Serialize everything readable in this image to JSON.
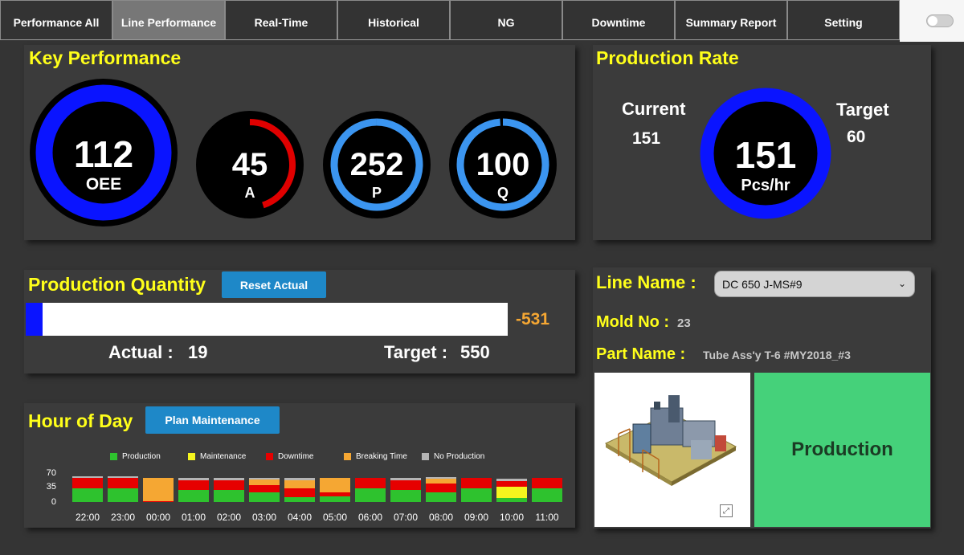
{
  "nav": {
    "tabs": [
      "Performance All",
      "Line Performance",
      "Real-Time",
      "Historical",
      "NG",
      "Downtime",
      "Summary Report",
      "Setting"
    ],
    "active_index": 1
  },
  "key_performance": {
    "title": "Key Performance",
    "oee": {
      "value": "112",
      "label": "OEE",
      "color": "#0a14ff"
    },
    "a": {
      "value": "45",
      "label": "A",
      "color": "#e00000",
      "fraction": 0.45
    },
    "p": {
      "value": "252",
      "label": "P",
      "color": "#3b95f0",
      "fraction": 1.0
    },
    "q": {
      "value": "100",
      "label": "Q",
      "color": "#3b95f0",
      "fraction": 0.99
    }
  },
  "production_rate": {
    "title": "Production Rate",
    "current_label": "Current",
    "current_value": "151",
    "target_label": "Target",
    "target_value": "60",
    "gauge_value": "151",
    "gauge_unit": "Pcs/hr",
    "color": "#0a14ff"
  },
  "production_quantity": {
    "title": "Production Quantity",
    "reset_button": "Reset Actual",
    "difference": "-531",
    "actual_label": "Actual :",
    "actual_value": "19",
    "target_label": "Target :",
    "target_value": "550",
    "progress_fraction": 0.0345
  },
  "hour_of_day": {
    "title": "Hour of Day",
    "plan_button": "Plan Maintenance",
    "legend": [
      {
        "name": "Production",
        "color": "#2ec22e"
      },
      {
        "name": "Maintenance",
        "color": "#f5f51e"
      },
      {
        "name": "Downtime",
        "color": "#e60000"
      },
      {
        "name": "Breaking Time",
        "color": "#f5a733"
      },
      {
        "name": "No Production",
        "color": "#b5b5b5"
      }
    ]
  },
  "chart_data": {
    "type": "bar",
    "stacked": true,
    "categories": [
      "22:00",
      "23:00",
      "00:00",
      "01:00",
      "02:00",
      "03:00",
      "04:00",
      "05:00",
      "06:00",
      "07:00",
      "08:00",
      "09:00",
      "10:00",
      "11:00"
    ],
    "yticks": [
      "70",
      "35",
      "0"
    ],
    "ylim": [
      0,
      70
    ],
    "series": [
      {
        "name": "Production",
        "values": [
          35,
          35,
          0,
          30,
          30,
          25,
          12,
          15,
          35,
          30,
          25,
          35,
          10,
          35
        ]
      },
      {
        "name": "Maintenance",
        "values": [
          0,
          0,
          0,
          0,
          0,
          0,
          0,
          0,
          0,
          0,
          0,
          0,
          28,
          0
        ]
      },
      {
        "name": "Downtime",
        "values": [
          25,
          25,
          2,
          25,
          25,
          17,
          22,
          10,
          25,
          25,
          22,
          25,
          15,
          25
        ]
      },
      {
        "name": "Breaking Time",
        "values": [
          0,
          0,
          58,
          0,
          0,
          15,
          20,
          35,
          0,
          0,
          12,
          0,
          0,
          0
        ]
      },
      {
        "name": "No Production",
        "values": [
          5,
          5,
          0,
          5,
          5,
          3,
          6,
          0,
          0,
          5,
          3,
          0,
          5,
          0
        ]
      }
    ]
  },
  "line": {
    "line_name_label": "Line Name :",
    "line_name_value": "DC 650 J-MS#9",
    "mold_label": "Mold No :",
    "mold_value": "23",
    "part_label": "Part Name :",
    "part_value": "Tube Ass'y T-6 #MY2018_#3",
    "status": "Production",
    "status_color": "#45d17a"
  }
}
